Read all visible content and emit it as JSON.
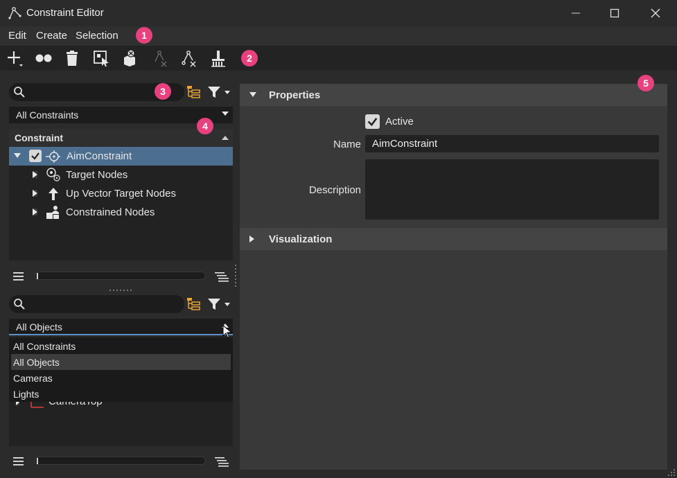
{
  "window": {
    "title": "Constraint Editor"
  },
  "menu": [
    "Edit",
    "Create",
    "Selection"
  ],
  "toolbar": {
    "icons": [
      "add-icon",
      "connect-icon",
      "delete-icon",
      "select-icon",
      "constrain-icon",
      "disabled-remove-target-icon",
      "remove-node-icon",
      "clean-icon"
    ]
  },
  "badges": [
    "1",
    "2",
    "3",
    "4",
    "5"
  ],
  "constraints_panel": {
    "search_placeholder": "",
    "filter_combo": "All Constraints",
    "tree_header": "Constraint",
    "rows": [
      {
        "label": "AimConstraint",
        "checked": true
      },
      {
        "label": "Target Nodes"
      },
      {
        "label": "Up Vector Target Nodes"
      },
      {
        "label": "Constrained Nodes"
      }
    ]
  },
  "objects_panel": {
    "search_placeholder": "",
    "filter_combo": "All Objects",
    "dropdown_options": [
      "All Constraints",
      "All Objects",
      "Cameras",
      "Lights"
    ],
    "selected_option": "All Objects",
    "partial_row": "CameraTop"
  },
  "properties": {
    "section_properties": "Properties",
    "active_label": "Active",
    "active_checked": true,
    "name_label": "Name",
    "name_value": "AimConstraint",
    "description_label": "Description",
    "description_value": "",
    "section_visualization": "Visualization"
  },
  "colors": {
    "accent_badge": "#e8417f",
    "selection": "#4d6f8f",
    "tree_icon_orange": "#e8a23a"
  }
}
